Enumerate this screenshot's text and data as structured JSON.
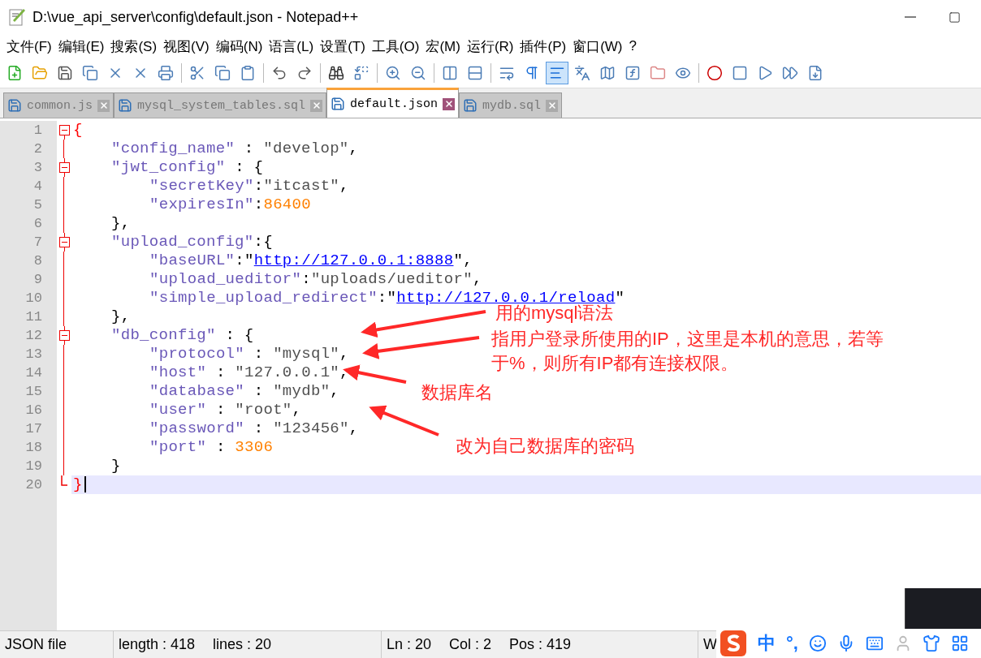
{
  "window": {
    "title": "D:\\vue_api_server\\config\\default.json - Notepad++"
  },
  "menu": [
    "文件(F)",
    "编辑(E)",
    "搜索(S)",
    "视图(V)",
    "编码(N)",
    "语言(L)",
    "设置(T)",
    "工具(O)",
    "宏(M)",
    "运行(R)",
    "插件(P)",
    "窗口(W)",
    "?"
  ],
  "toolbar": [
    {
      "kind": "new",
      "pressed": false
    },
    {
      "kind": "open",
      "pressed": false
    },
    {
      "kind": "save",
      "pressed": false
    },
    {
      "kind": "saveall",
      "pressed": false
    },
    {
      "kind": "close",
      "pressed": false
    },
    {
      "kind": "closeall",
      "pressed": false
    },
    {
      "kind": "print",
      "pressed": false
    },
    {
      "kind": "sep"
    },
    {
      "kind": "cut",
      "pressed": false
    },
    {
      "kind": "copy",
      "pressed": false
    },
    {
      "kind": "paste",
      "pressed": false
    },
    {
      "kind": "sep"
    },
    {
      "kind": "undo",
      "pressed": false
    },
    {
      "kind": "redo",
      "pressed": false
    },
    {
      "kind": "sep"
    },
    {
      "kind": "find",
      "pressed": false
    },
    {
      "kind": "replace",
      "pressed": false
    },
    {
      "kind": "sep"
    },
    {
      "kind": "zoomin",
      "pressed": false
    },
    {
      "kind": "zoomout",
      "pressed": false
    },
    {
      "kind": "sep"
    },
    {
      "kind": "sync",
      "pressed": false
    },
    {
      "kind": "synch",
      "pressed": false
    },
    {
      "kind": "sep"
    },
    {
      "kind": "wrap",
      "pressed": false
    },
    {
      "kind": "allchars",
      "pressed": false
    },
    {
      "kind": "guide",
      "pressed": true
    },
    {
      "kind": "lang",
      "pressed": false
    },
    {
      "kind": "map",
      "pressed": false
    },
    {
      "kind": "func",
      "pressed": false
    },
    {
      "kind": "folder",
      "pressed": false
    },
    {
      "kind": "monitor",
      "pressed": false
    },
    {
      "kind": "sep"
    },
    {
      "kind": "record",
      "pressed": false
    },
    {
      "kind": "stop",
      "pressed": false
    },
    {
      "kind": "play",
      "pressed": false
    },
    {
      "kind": "playmany",
      "pressed": false
    },
    {
      "kind": "savemacro",
      "pressed": false
    }
  ],
  "tabs": [
    {
      "label": "common.js",
      "selected": false
    },
    {
      "label": "mysql_system_tables.sql",
      "selected": false
    },
    {
      "label": "default.json",
      "selected": true
    },
    {
      "label": "mydb.sql",
      "selected": false
    }
  ],
  "lines": [
    {
      "number": "1",
      "fold_start": true,
      "fold_end": false,
      "current": false,
      "tokens": [
        {
          "kind": "brace",
          "text": "{"
        }
      ]
    },
    {
      "number": "2",
      "fold_start": false,
      "fold_end": false,
      "current": false,
      "tokens": [
        {
          "kind": "key",
          "text": "\"config_name\""
        },
        {
          "kind": "plain",
          "text": " : "
        },
        {
          "kind": "str",
          "text": "\"develop\""
        },
        {
          "kind": "plain",
          "text": ","
        }
      ]
    },
    {
      "number": "3",
      "fold_start": true,
      "fold_end": false,
      "current": false,
      "tokens": [
        {
          "kind": "key",
          "text": "\"jwt_config\""
        },
        {
          "kind": "plain",
          "text": " : {"
        }
      ]
    },
    {
      "number": "4",
      "fold_start": false,
      "fold_end": false,
      "current": false,
      "tokens": [
        {
          "kind": "key",
          "text": "\"secretKey\""
        },
        {
          "kind": "plain",
          "text": ":"
        },
        {
          "kind": "str",
          "text": "\"itcast\""
        },
        {
          "kind": "plain",
          "text": ","
        }
      ]
    },
    {
      "number": "5",
      "fold_start": false,
      "fold_end": false,
      "current": false,
      "tokens": [
        {
          "kind": "key",
          "text": "\"expiresIn\""
        },
        {
          "kind": "plain",
          "text": ":"
        },
        {
          "kind": "num",
          "text": "86400"
        }
      ]
    },
    {
      "number": "6",
      "fold_start": false,
      "fold_end": false,
      "current": false,
      "tokens": [
        {
          "kind": "plain",
          "text": "},"
        }
      ]
    },
    {
      "number": "7",
      "fold_start": true,
      "fold_end": false,
      "current": false,
      "tokens": [
        {
          "kind": "key",
          "text": "\"upload_config\""
        },
        {
          "kind": "plain",
          "text": ":{"
        }
      ]
    },
    {
      "number": "8",
      "fold_start": false,
      "fold_end": false,
      "current": false,
      "tokens": [
        {
          "kind": "key",
          "text": "\"baseURL\""
        },
        {
          "kind": "plain",
          "text": ":\""
        },
        {
          "kind": "link",
          "text": "http://127.0.0.1:8888"
        },
        {
          "kind": "plain",
          "text": "\","
        }
      ]
    },
    {
      "number": "9",
      "fold_start": false,
      "fold_end": false,
      "current": false,
      "tokens": [
        {
          "kind": "key",
          "text": "\"upload_ueditor\""
        },
        {
          "kind": "plain",
          "text": ":"
        },
        {
          "kind": "str",
          "text": "\"uploads/ueditor\""
        },
        {
          "kind": "plain",
          "text": ","
        }
      ]
    },
    {
      "number": "10",
      "fold_start": false,
      "fold_end": false,
      "current": false,
      "tokens": [
        {
          "kind": "key",
          "text": "\"simple_upload_redirect\""
        },
        {
          "kind": "plain",
          "text": ":\""
        },
        {
          "kind": "link",
          "text": "http://127.0.0.1/reload"
        },
        {
          "kind": "plain",
          "text": "\""
        }
      ]
    },
    {
      "number": "11",
      "fold_start": false,
      "fold_end": false,
      "current": false,
      "tokens": [
        {
          "kind": "plain",
          "text": "},"
        }
      ]
    },
    {
      "number": "12",
      "fold_start": true,
      "fold_end": false,
      "current": false,
      "tokens": [
        {
          "kind": "key",
          "text": "\"db_config\""
        },
        {
          "kind": "plain",
          "text": " : {"
        }
      ]
    },
    {
      "number": "13",
      "fold_start": false,
      "fold_end": false,
      "current": false,
      "tokens": [
        {
          "kind": "key",
          "text": "\"protocol\""
        },
        {
          "kind": "plain",
          "text": " : "
        },
        {
          "kind": "str",
          "text": "\"mysql\""
        },
        {
          "kind": "plain",
          "text": ","
        }
      ]
    },
    {
      "number": "14",
      "fold_start": false,
      "fold_end": false,
      "current": false,
      "tokens": [
        {
          "kind": "key",
          "text": "\"host\""
        },
        {
          "kind": "plain",
          "text": " : "
        },
        {
          "kind": "str",
          "text": "\"127.0.0.1\""
        },
        {
          "kind": "plain",
          "text": ","
        }
      ]
    },
    {
      "number": "15",
      "fold_start": false,
      "fold_end": false,
      "current": false,
      "tokens": [
        {
          "kind": "key",
          "text": "\"database\""
        },
        {
          "kind": "plain",
          "text": " : "
        },
        {
          "kind": "str",
          "text": "\"mydb\""
        },
        {
          "kind": "plain",
          "text": ","
        }
      ]
    },
    {
      "number": "16",
      "fold_start": false,
      "fold_end": false,
      "current": false,
      "tokens": [
        {
          "kind": "key",
          "text": "\"user\""
        },
        {
          "kind": "plain",
          "text": " : "
        },
        {
          "kind": "str",
          "text": "\"root\""
        },
        {
          "kind": "plain",
          "text": ","
        }
      ]
    },
    {
      "number": "17",
      "fold_start": false,
      "fold_end": false,
      "current": false,
      "tokens": [
        {
          "kind": "key",
          "text": "\"password\""
        },
        {
          "kind": "plain",
          "text": " : "
        },
        {
          "kind": "str",
          "text": "\"123456\""
        },
        {
          "kind": "plain",
          "text": ","
        }
      ]
    },
    {
      "number": "18",
      "fold_start": false,
      "fold_end": false,
      "current": false,
      "tokens": [
        {
          "kind": "key",
          "text": "\"port\""
        },
        {
          "kind": "plain",
          "text": " : "
        },
        {
          "kind": "num",
          "text": "3306"
        }
      ]
    },
    {
      "number": "19",
      "fold_start": false,
      "fold_end": false,
      "current": false,
      "tokens": [
        {
          "kind": "plain",
          "text": "}"
        }
      ]
    },
    {
      "number": "20",
      "fold_start": false,
      "fold_end": true,
      "current": true,
      "tokens": [
        {
          "kind": "brace",
          "text": "}"
        }
      ]
    }
  ],
  "annotations": [
    {
      "text": "用的mysql语法"
    },
    {
      "text": "指用户登录所使用的IP，这里是本机的意思，若等于%，则所有IP都有连接权限。"
    },
    {
      "text": "数据库名"
    },
    {
      "text": "改为自己数据库的密码"
    }
  ],
  "status_bar": {
    "type": "JSON file",
    "length": "length : 418",
    "lines": "lines : 20",
    "ln": "Ln : 20",
    "col": "Col : 2",
    "pos": "Pos : 419",
    "cut": "W"
  },
  "ime_bar": {
    "mode": "中",
    "punct": "°,"
  }
}
